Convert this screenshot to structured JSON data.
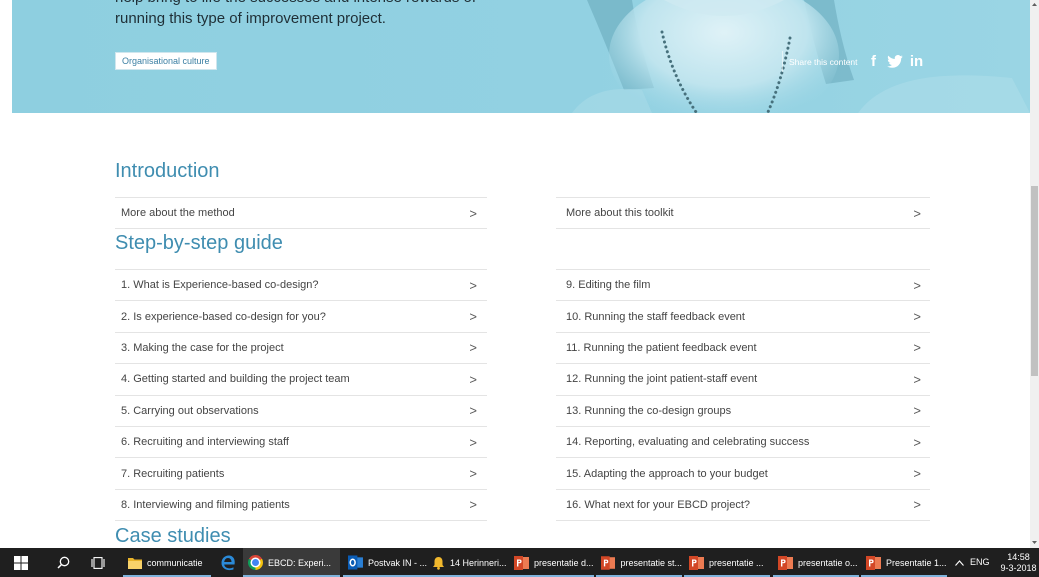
{
  "hero": {
    "intro_line_1": "help bring to life the successes and intense rewards of",
    "intro_line_2": "running this type of improvement project.",
    "tag_label": "Organisational culture",
    "share_label": "Share this content",
    "social": [
      {
        "icon": "facebook-icon",
        "glyph": "f"
      },
      {
        "icon": "twitter-icon"
      },
      {
        "icon": "linkedin-icon",
        "glyph": "in"
      }
    ]
  },
  "introduction": {
    "title": "Introduction",
    "left": [
      {
        "label": "More about the method"
      }
    ],
    "right": [
      {
        "label": "More about this toolkit"
      }
    ]
  },
  "guide": {
    "title": "Step-by-step guide",
    "left": [
      {
        "label": "1. What is Experience-based co-design?"
      },
      {
        "label": "2. Is experience-based co-design for you?"
      },
      {
        "label": "3. Making the case for the project"
      },
      {
        "label": "4. Getting started and building the project team"
      },
      {
        "label": "5. Carrying out observations"
      },
      {
        "label": "6. Recruiting and interviewing staff"
      },
      {
        "label": "7. Recruiting patients"
      },
      {
        "label": "8. Interviewing and filming patients"
      }
    ],
    "right": [
      {
        "label": "9. Editing the film"
      },
      {
        "label": "10. Running the staff feedback event"
      },
      {
        "label": "11. Running the patient feedback event"
      },
      {
        "label": "12. Running the joint patient-staff event"
      },
      {
        "label": "13. Running the co-design groups"
      },
      {
        "label": "14. Reporting, evaluating and celebrating success"
      },
      {
        "label": "15. Adapting the approach to your budget"
      },
      {
        "label": "16. What next for your EBCD project?"
      }
    ]
  },
  "case_studies": {
    "title": "Case studies"
  },
  "common": {
    "chevron": ">"
  },
  "taskbar": {
    "items": [
      {
        "icon": "folder-icon",
        "label": "communicatie"
      },
      {
        "icon": "edge-icon"
      },
      {
        "icon": "chrome-icon",
        "label": "EBCD: Experi..."
      },
      {
        "icon": "outlook-icon",
        "label": "Postvak IN - ..."
      },
      {
        "icon": "bell-icon",
        "label": "14 Herinneri..."
      },
      {
        "icon": "powerpoint-icon",
        "label": "presentatie d..."
      },
      {
        "icon": "powerpoint-icon",
        "label": "presentatie st..."
      },
      {
        "icon": "powerpoint-icon",
        "label": "presentatie ..."
      },
      {
        "icon": "powerpoint-icon",
        "label": "presentatie o..."
      },
      {
        "icon": "powerpoint-icon",
        "label": "Presentatie 1..."
      }
    ],
    "tray": {
      "language": "ENG",
      "time": "14:58",
      "date": "9-3-2018"
    }
  },
  "colors": {
    "hero_background": "#8fd0e1",
    "heading": "#3f8db0",
    "tag_text": "#3b7fa3",
    "taskbar": "#1f1f1f"
  }
}
